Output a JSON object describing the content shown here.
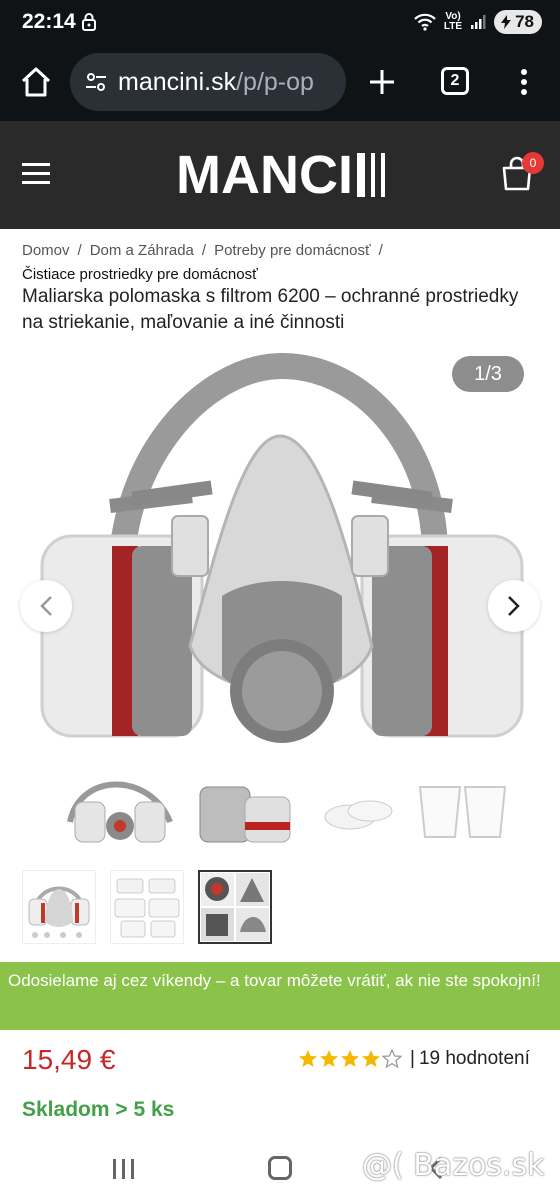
{
  "status_bar": {
    "time": "22:14",
    "lte_label": "Vo)\nLTE",
    "battery": "78"
  },
  "browser": {
    "url_host": "mancini.sk",
    "url_path": "/p/p-op",
    "tab_count": "2"
  },
  "site": {
    "logo": "MANCI",
    "cart_count": "0"
  },
  "breadcrumb": {
    "items": [
      "Domov",
      "Dom a Záhrada",
      "Potreby pre domácnosť"
    ],
    "current": "Čistiace prostriedky pre domácnosť"
  },
  "product": {
    "title": "Maliarska polomaska s filtrom 6200 – ochranné prostriedky na striekanie, maľovanie a iné činnosti",
    "image_counter": "1/3",
    "image_description": "Half face respirator mask with filters",
    "thumbnails": [
      "mask-set",
      "filter-packs",
      "mask-collage"
    ],
    "price": "15,49 €",
    "rating_value": 4,
    "rating_max": 5,
    "reviews": "19 hodnotení",
    "stock": "Skladom > 5 ks"
  },
  "promo": {
    "text": "Odosielame aj cez víkendy – a tovar môžete vrátiť, ak nie ste spokojní!"
  },
  "watermark": "@( Bazos.sk",
  "colors": {
    "header_bg": "#2a2a2a",
    "promo_bg": "#8bc34a",
    "price": "#c62828",
    "stock": "#43a047",
    "star": "#f5b800"
  }
}
